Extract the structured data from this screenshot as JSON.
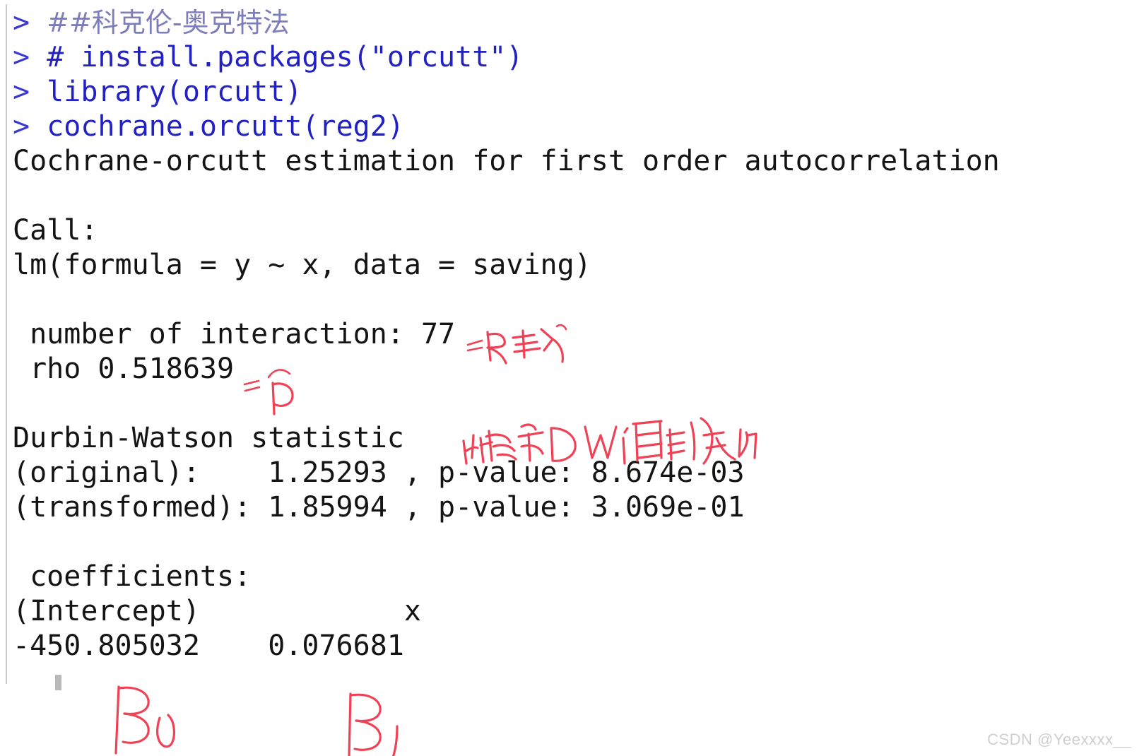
{
  "app": {
    "kind": "r-console-output",
    "watermark": "CSDN @Yeexxxx__",
    "colors": {
      "background": "#ffffff",
      "prompt_blue": "#2222c4",
      "comment_purple": "#7d7dbb",
      "output_black": "#141414",
      "annotation_red": "#ef4256",
      "gutter_gray": "#c9c9c9",
      "watermark_gray": "#cfcfcf"
    }
  },
  "console": {
    "prompt_symbol": ">",
    "lines": [
      {
        "id": "l01",
        "kind": "prompt",
        "prompt": "> ",
        "text": "##科克伦-奥克特法",
        "style": "comment-cn"
      },
      {
        "id": "l02",
        "kind": "prompt",
        "prompt": "> ",
        "text": "# install.packages(\"orcutt\")",
        "style": "code"
      },
      {
        "id": "l03",
        "kind": "prompt",
        "prompt": "> ",
        "text": "library(orcutt)",
        "style": "code"
      },
      {
        "id": "l04",
        "kind": "prompt",
        "prompt": "> ",
        "text": "cochrane.orcutt(reg2)",
        "style": "code"
      },
      {
        "id": "l05",
        "kind": "output",
        "text": "Cochrane-orcutt estimation for first order autocorrelation"
      },
      {
        "id": "l06",
        "kind": "blank",
        "text": " "
      },
      {
        "id": "l07",
        "kind": "output",
        "text": "Call:"
      },
      {
        "id": "l08",
        "kind": "output",
        "text": "lm(formula = y ~ x, data = saving)"
      },
      {
        "id": "l09",
        "kind": "blank",
        "text": " "
      },
      {
        "id": "l10",
        "kind": "output",
        "text": " number of interaction: 77"
      },
      {
        "id": "l11",
        "kind": "output",
        "text": " rho 0.518639"
      },
      {
        "id": "l12",
        "kind": "blank",
        "text": " "
      },
      {
        "id": "l13",
        "kind": "output",
        "text": "Durbin-Watson statistic"
      },
      {
        "id": "l14",
        "kind": "output",
        "text": "(original):    1.25293 , p-value: 8.674e-03"
      },
      {
        "id": "l15",
        "kind": "output",
        "text": "(transformed): 1.85994 , p-value: 3.069e-01"
      },
      {
        "id": "l16",
        "kind": "blank",
        "text": " "
      },
      {
        "id": "l17",
        "kind": "output",
        "text": " coefficients:"
      },
      {
        "id": "l18",
        "kind": "output",
        "text": "(Intercept)            x"
      },
      {
        "id": "l19",
        "kind": "output",
        "text": "-450.805032    0.076681"
      }
    ]
  },
  "results": {
    "method_title": "Cochrane-orcutt estimation for first order autocorrelation",
    "call_label": "Call:",
    "call_formula": "lm(formula = y ~ x, data = saving)",
    "number_of_interaction_label": "number of interaction:",
    "number_of_interaction": "77",
    "rho_label": "rho",
    "rho": "0.518639",
    "durbin_watson_label": "Durbin-Watson statistic",
    "dw_original_label": "(original):",
    "dw_original": "1.25293",
    "dw_original_p_label": "p-value:",
    "dw_original_p": "8.674e-03",
    "dw_transformed_label": "(transformed):",
    "dw_transformed": "1.85994",
    "dw_transformed_p_label": "p-value:",
    "dw_transformed_p": "3.069e-01",
    "coefficients_label": "coefficients:",
    "coef_names": [
      "(Intercept)",
      "x"
    ],
    "coef_values": [
      "-450.805032",
      "0.076681"
    ]
  },
  "annotations": [
    {
      "id": "a1",
      "name": "iteration-count-note",
      "text": "=迭代次数",
      "near": "number of interaction: 77"
    },
    {
      "id": "a2",
      "name": "rho-hat-note",
      "text": "=ρ̂",
      "near": "rho 0.518639"
    },
    {
      "id": "a3",
      "name": "dw-comparison-note",
      "text": "比较两DW值的变化",
      "near": "Durbin-Watson statistic"
    },
    {
      "id": "a4",
      "name": "beta0-note",
      "text": "β₀",
      "near": "-450.805032"
    },
    {
      "id": "a5",
      "name": "beta1-note",
      "text": "β₁",
      "near": "0.076681"
    }
  ]
}
